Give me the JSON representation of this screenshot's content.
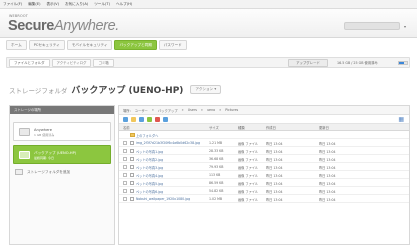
{
  "menubar": [
    "ファイル(F)",
    "編集(E)",
    "表示(V)",
    "お気に入り(A)",
    "ツール(T)",
    "ヘルプ(H)"
  ],
  "brand": {
    "small": "WEBROOT",
    "name_strong": "Secure",
    "name_light": "Anywhere."
  },
  "main_tabs": [
    {
      "label": "ホーム",
      "active": false
    },
    {
      "label": "PCセキュリティ",
      "active": false
    },
    {
      "label": "モバイルセキュリティ",
      "active": false
    },
    {
      "label": "バックアップと同期",
      "active": true
    },
    {
      "label": "パスワード",
      "active": false
    }
  ],
  "sub_tabs": [
    {
      "label": "ファイルとフォルダ",
      "active": true
    },
    {
      "label": "アクティビティログ",
      "active": false
    },
    {
      "label": "ゴミ箱",
      "active": false
    }
  ],
  "usage": {
    "button": "アップグレード",
    "text": "16.5 GB / 25 GB 使用済み",
    "fraction": 0.66,
    "fill_color": "#3b86d8"
  },
  "page_title": {
    "prefix": "ストレージフォルダ",
    "name": "バックアップ (UENO-HP)",
    "action": "アクション ▾"
  },
  "left_panel": {
    "header": "ストレージの場所",
    "items": [
      {
        "name": "Anywhere",
        "sub": "1 GB 使用済み",
        "active": false
      },
      {
        "name": "バックアップ (UENO-HP)",
        "sub": "最終同期: 今日",
        "active": true
      }
    ],
    "plain_item": "ストレージフォルダを追加"
  },
  "path": [
    "場所:",
    "ユーザー",
    "»",
    "バックアップ",
    "»",
    "Users",
    "»",
    "ueno",
    "»",
    "Pictures"
  ],
  "columns": {
    "name": "名前",
    "size": "サイズ",
    "type": "種類",
    "date": "作成日",
    "modified": "更新日"
  },
  "rows": [
    {
      "name": "上のフォルダへ",
      "size": "",
      "type": "",
      "date": "",
      "modified": "",
      "folder": true
    },
    {
      "name": "img_2f3f7d21b3f20f6c4a6b0d62c38.jpg",
      "size": "1.21 MB",
      "type": "画像 ファイル",
      "date": "昨日 13:04",
      "modified": "昨日 13:04",
      "folder": false
    },
    {
      "name": "ペットの写真1.jpg",
      "size": "28.33 KB",
      "type": "画像 ファイル",
      "date": "昨日 13:04",
      "modified": "昨日 13:04",
      "folder": false
    },
    {
      "name": "ペットの写真2.jpg",
      "size": "36.68 KB",
      "type": "画像 ファイル",
      "date": "昨日 13:04",
      "modified": "昨日 13:04",
      "folder": false
    },
    {
      "name": "ペットの写真3.jpg",
      "size": "79.93 KB",
      "type": "画像 ファイル",
      "date": "昨日 13:04",
      "modified": "昨日 13:04",
      "folder": false
    },
    {
      "name": "ペットの写真4.jpg",
      "size": "113 KB",
      "type": "画像 ファイル",
      "date": "昨日 13:04",
      "modified": "昨日 13:04",
      "folder": false
    },
    {
      "name": "ペットの写真5.jpg",
      "size": "86.59 KB",
      "type": "画像 ファイル",
      "date": "昨日 13:04",
      "modified": "昨日 13:04",
      "folder": false
    },
    {
      "name": "ペットの写真6.jpg",
      "size": "54.82 KB",
      "type": "画像 ファイル",
      "date": "昨日 13:04",
      "modified": "昨日 13:04",
      "folder": false
    },
    {
      "name": "Nobuhi_wallpaper_1920x1080.jpg",
      "size": "1.02 MB",
      "type": "画像 ファイル",
      "date": "昨日 13:04",
      "modified": "昨日 13:04",
      "folder": false
    }
  ],
  "toolbar_icons": [
    {
      "name": "upload-icon",
      "color": "#5aa0dd"
    },
    {
      "name": "new-folder-icon",
      "color": "#f1c75c"
    },
    {
      "name": "download-icon",
      "color": "#5aa0dd"
    },
    {
      "name": "share-icon",
      "color": "#8cc63f"
    },
    {
      "name": "delete-icon",
      "color": "#e0574f"
    },
    {
      "name": "refresh-icon",
      "color": "#5aa0dd"
    }
  ],
  "view_icon": "grid-view-icon"
}
